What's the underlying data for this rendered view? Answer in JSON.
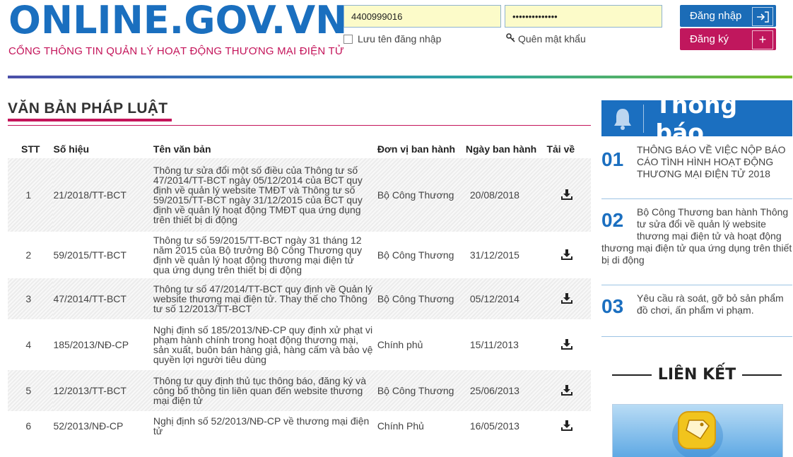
{
  "header": {
    "logo_title": "ONLINE.GOV.VN",
    "logo_subtitle": "CỔNG THÔNG TIN QUẢN LÝ HOẠT ĐỘNG THƯƠNG MẠI ĐIỆN TỬ",
    "username_value": "4400999016",
    "password_value": "••••••••••••••",
    "remember_label": "Lưu tên đăng nhập",
    "forgot_label": "Quên mật khẩu",
    "login_label": "Đăng nhập",
    "register_label": "Đăng ký"
  },
  "main": {
    "section_title": "VĂN BẢN PHÁP LUẬT",
    "columns": [
      "STT",
      "Số hiệu",
      "Tên văn bản",
      "Đơn vị ban hành",
      "Ngày ban hành",
      "Tải về"
    ],
    "rows": [
      {
        "stt": "1",
        "so_hieu": "21/2018/TT-BCT",
        "ten": "Thông tư sửa đổi một số điều của Thông tư số 47/2014/TT-BCT ngày 05/12/2014 của BCT quy định về quản lý website TMĐT và Thông tư số 59/2015/TT-BCT ngày 31/12/2015 của BCT quy định về quản lý hoạt động TMĐT qua ứng dụng trên thiết bị di động",
        "don_vi": "Bộ Công Thương",
        "ngay": "20/08/2018"
      },
      {
        "stt": "2",
        "so_hieu": "59/2015/TT-BCT",
        "ten": "Thông tư số 59/2015/TT-BCT ngày 31 tháng 12 năm 2015 của Bộ trưởng Bộ Công Thương quy định về quản lý hoạt động thương mại điện tử qua ứng dụng trên thiết bị di động",
        "don_vi": "Bộ Công Thương",
        "ngay": "31/12/2015"
      },
      {
        "stt": "3",
        "so_hieu": "47/2014/TT-BCT",
        "ten": "Thông tư số 47/2014/TT-BCT quy định về Quản lý website thương mại điện tử. Thay thế cho Thông tư số 12/2013/TT-BCT",
        "don_vi": "Bộ Công Thương",
        "ngay": "05/12/2014"
      },
      {
        "stt": "4",
        "so_hieu": "185/2013/NĐ-CP",
        "ten": "Nghị định số 185/2013/NĐ-CP quy định xử phạt vi phạm hành chính trong hoạt động thương mại, sản xuất, buôn bán hàng giả, hàng cấm và bảo vệ quyền lợi người tiêu dùng",
        "don_vi": "Chính phủ",
        "ngay": "15/11/2013"
      },
      {
        "stt": "5",
        "so_hieu": "12/2013/TT-BCT",
        "ten": "Thông tư quy định thủ tục thông báo, đăng ký và công bố thông tin liên quan đến website thương mại điện tử",
        "don_vi": "Bộ Công Thương",
        "ngay": "25/06/2013"
      },
      {
        "stt": "6",
        "so_hieu": "52/2013/NĐ-CP",
        "ten": "Nghị định số 52/2013/NĐ-CP về thương mại điện tử",
        "don_vi": "Chính Phủ",
        "ngay": "16/05/2013"
      }
    ]
  },
  "sidebar": {
    "notice_title": "Thông báo",
    "notices": [
      {
        "num": "01",
        "text": "THÔNG BÁO VỀ VIỆC NỘP BÁO CÁO TÌNH HÌNH HOẠT ĐỘNG THƯƠNG MẠI ĐIỆN TỬ 2018"
      },
      {
        "num": "02",
        "text": "Bộ Công Thương ban hành Thông tư sửa đổi về quản lý website thương mại điện tử và hoạt động thương mại điện tử qua ứng dụng trên thiết bị di động"
      },
      {
        "num": "03",
        "text": "Yêu cầu rà soát, gỡ bỏ sản phẩm đồ chơi, ấn phẩm vi phạm."
      }
    ],
    "links_title": "LIÊN KẾT"
  },
  "colors": {
    "brand_blue": "#1a6fbf",
    "brand_magenta": "#c4145a"
  }
}
